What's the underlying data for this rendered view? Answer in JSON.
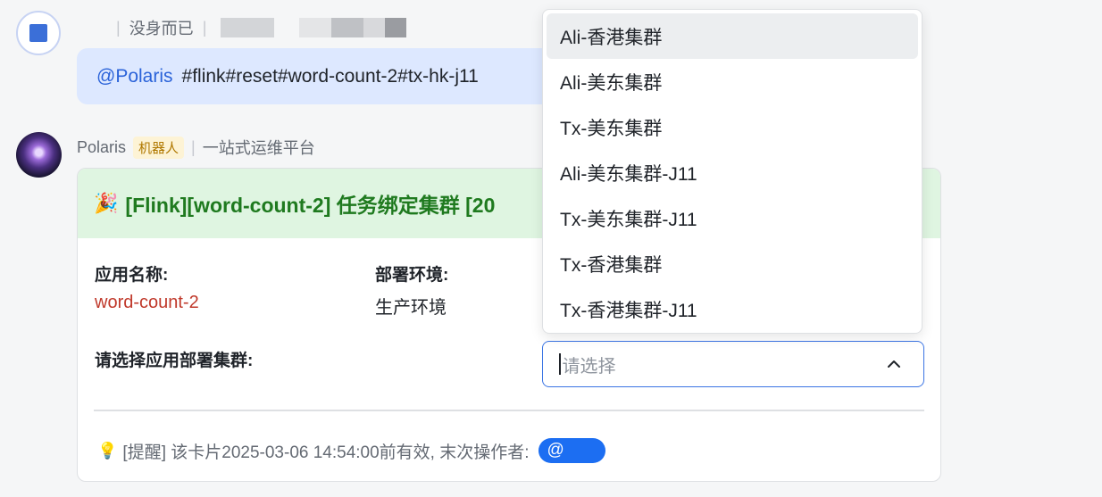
{
  "user_message": {
    "meta_text": "没身而已",
    "mention": "@Polaris",
    "command": "#flink#reset#word-count-2#tx-hk-j11"
  },
  "bot_message": {
    "name": "Polaris",
    "badge": "机器人",
    "platform": "一站式运维平台",
    "card": {
      "title": "[Flink][word-count-2] 任务绑定集群 [20",
      "app_name_label": "应用名称:",
      "app_name_value": "word-count-2",
      "env_label": "部署环境:",
      "env_value": "生产环境",
      "cluster_label": "请选择应用部署集群:",
      "footer_text": "[提醒] 该卡片2025-03-06 14:54:00前有效, 末次操作者:",
      "at_symbol": "@"
    }
  },
  "select": {
    "placeholder": "请选择",
    "options": [
      "Ali-香港集群",
      "Ali-美东集群",
      "Tx-美东集群",
      "Ali-美东集群-J11",
      "Tx-美东集群-J11",
      "Tx-香港集群",
      "Tx-香港集群-J11"
    ],
    "hovered_index": 0
  },
  "colors": {
    "mention": "#2b63d9",
    "header_bg": "#dff5e1",
    "header_text": "#1f7a1f",
    "select_border": "#3a74e4",
    "at_chip": "#1c6ef2"
  }
}
